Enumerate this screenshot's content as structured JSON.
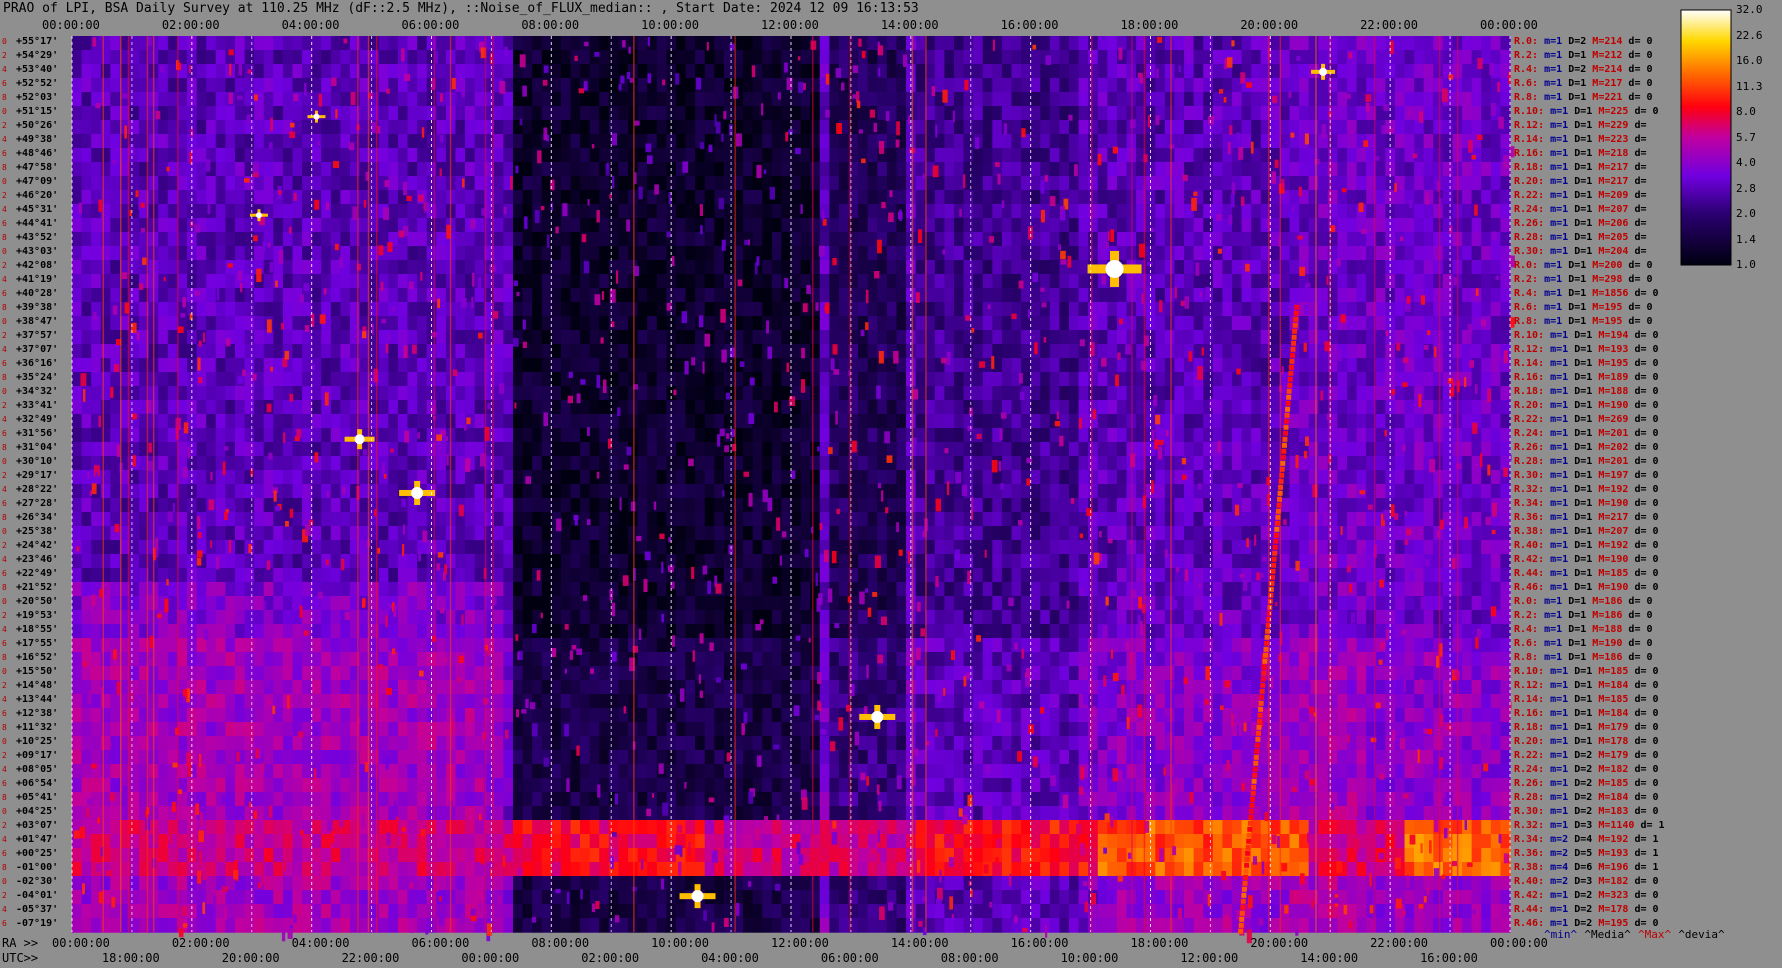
{
  "title": "PRAO of LPI, BSA Daily Survey at 110.25 MHz (dF::2.5 MHz), ::Noise_of_FLUX_median:: , Start Date: 2024 12 09 16:13:53",
  "chart_data": {
    "type": "heatmap",
    "title": "PRAO of LPI, BSA Daily Survey at 110.25 MHz (dF::2.5 MHz), ::Noise_of_FLUX_median:: , Start Date: 2024 12 09 16:13:53",
    "x_top_ticks": [
      "00:00:00",
      "02:00:00",
      "04:00:00",
      "06:00:00",
      "08:00:00",
      "10:00:00",
      "12:00:00",
      "14:00:00",
      "16:00:00",
      "18:00:00",
      "20:00:00",
      "22:00:00",
      "00:00:00"
    ],
    "x_bottom_ra_label": "RA >>",
    "x_bottom_ra_ticks": [
      "00:00:00",
      "02:00:00",
      "04:00:00",
      "06:00:00",
      "08:00:00",
      "10:00:00",
      "12:00:00",
      "14:00:00",
      "16:00:00",
      "18:00:00",
      "20:00:00",
      "22:00:00",
      "00:00:00"
    ],
    "x_bottom_utc_label": "UTC>>",
    "x_bottom_utc_ticks": [
      "18:00:00",
      "20:00:00",
      "22:00:00",
      "00:00:00",
      "02:00:00",
      "04:00:00",
      "06:00:00",
      "08:00:00",
      "10:00:00",
      "12:00:00",
      "14:00:00",
      "16:00:00"
    ],
    "colorbar": {
      "ticks": [
        "32.0",
        "22.6",
        "16.0",
        "11.3",
        "8.0",
        "5.7",
        "4.0",
        "2.8",
        "2.0",
        "1.4",
        "1.0"
      ],
      "scale": "log",
      "range": [
        1.0,
        32.0
      ]
    },
    "y_declinations": [
      "+55°17'",
      "+54°29'",
      "+53°40'",
      "+52°52'",
      "+52°03'",
      "+51°15'",
      "+50°26'",
      "+49°38'",
      "+48°46'",
      "+47°58'",
      "+47°09'",
      "+46°20'",
      "+45°31'",
      "+44°41'",
      "+43°52'",
      "+43°03'",
      "+42°08'",
      "+41°19'",
      "+40°28'",
      "+39°38'",
      "+38°47'",
      "+37°57'",
      "+37°07'",
      "+36°16'",
      "+35°24'",
      "+34°32'",
      "+33°41'",
      "+32°49'",
      "+31°56'",
      "+31°04'",
      "+30°10'",
      "+29°17'",
      "+28°22'",
      "+27°28'",
      "+26°34'",
      "+25°38'",
      "+24°42'",
      "+23°46'",
      "+22°49'",
      "+21°52'",
      "+20°50'",
      "+19°53'",
      "+18°55'",
      "+17°55'",
      "+16°52'",
      "+15°50'",
      "+14°48'",
      "+13°44'",
      "+12°38'",
      "+11°32'",
      "+10°25'",
      "+09°17'",
      "+08°05'",
      "+06°54'",
      "+05°41'",
      "+04°25'",
      "+03°07'",
      "+01°47'",
      "+00°25'",
      "-01°00'",
      "-02°30'",
      "-04°01'",
      "-05°37'",
      "-07°19'"
    ],
    "y_index_labels": [
      "0",
      "2",
      "4",
      "6",
      "8",
      "0",
      "2",
      "4",
      "6",
      "8",
      "0",
      "2",
      "4",
      "6",
      "8",
      "0",
      "2",
      "4",
      "6",
      "8",
      "0",
      "2",
      "4",
      "6",
      "8",
      "0",
      "2",
      "4",
      "6",
      "8",
      "0",
      "2",
      "4",
      "6",
      "8",
      "0",
      "2",
      "4",
      "6",
      "8",
      "0",
      "2",
      "4",
      "6",
      "8",
      "0",
      "2",
      "4",
      "6",
      "8",
      "0",
      "2",
      "4",
      "6",
      "8",
      "0",
      "2",
      "4",
      "6",
      "8",
      "0",
      "2",
      "4",
      "6"
    ],
    "stats_rows": [
      [
        "R.0:",
        "m=1",
        "D=2",
        "M=214",
        "d= 0"
      ],
      [
        "R.2:",
        "m=1",
        "D=1",
        "M=212",
        "d= 0"
      ],
      [
        "R.4:",
        "m=1",
        "D=2",
        "M=214",
        "d= 0"
      ],
      [
        "R.6:",
        "m=1",
        "D=1",
        "M=217",
        "d= 0"
      ],
      [
        "R.8:",
        "m=1",
        "D=1",
        "M=221",
        "d= 0"
      ],
      [
        "R.10:",
        "m=1",
        "D=1",
        "M=225",
        "d= 0"
      ],
      [
        "R.12:",
        "m=1",
        "D=1",
        "M=229",
        "d="
      ],
      [
        "R.14:",
        "m=1",
        "D=1",
        "M=223",
        "d="
      ],
      [
        "R.16:",
        "m=1",
        "D=1",
        "M=218",
        "d="
      ],
      [
        "R.18:",
        "m=1",
        "D=1",
        "M=217",
        "d="
      ],
      [
        "R.20:",
        "m=1",
        "D=1",
        "M=217",
        "d="
      ],
      [
        "R.22:",
        "m=1",
        "D=1",
        "M=209",
        "d="
      ],
      [
        "R.24:",
        "m=1",
        "D=1",
        "M=207",
        "d="
      ],
      [
        "R.26:",
        "m=1",
        "D=1",
        "M=206",
        "d="
      ],
      [
        "R.28:",
        "m=1",
        "D=1",
        "M=205",
        "d="
      ],
      [
        "R.30:",
        "m=1",
        "D=1",
        "M=204",
        "d="
      ],
      [
        "R.0:",
        "m=1",
        "D=1",
        "M=200",
        "d= 0"
      ],
      [
        "R.2:",
        "m=1",
        "D=1",
        "M=298",
        "d= 0"
      ],
      [
        "R.4:",
        "m=1",
        "D=1",
        "M=1856",
        "d= 0"
      ],
      [
        "R.6:",
        "m=1",
        "D=1",
        "M=195",
        "d= 0"
      ],
      [
        "R.8:",
        "m=1",
        "D=1",
        "M=195",
        "d= 0"
      ],
      [
        "R.10:",
        "m=1",
        "D=1",
        "M=194",
        "d= 0"
      ],
      [
        "R.12:",
        "m=1",
        "D=1",
        "M=193",
        "d= 0"
      ],
      [
        "R.14:",
        "m=1",
        "D=1",
        "M=195",
        "d= 0"
      ],
      [
        "R.16:",
        "m=1",
        "D=1",
        "M=189",
        "d= 0"
      ],
      [
        "R.18:",
        "m=1",
        "D=1",
        "M=188",
        "d= 0"
      ],
      [
        "R.20:",
        "m=1",
        "D=1",
        "M=190",
        "d= 0"
      ],
      [
        "R.22:",
        "m=1",
        "D=1",
        "M=269",
        "d= 0"
      ],
      [
        "R.24:",
        "m=1",
        "D=1",
        "M=201",
        "d= 0"
      ],
      [
        "R.26:",
        "m=1",
        "D=1",
        "M=202",
        "d= 0"
      ],
      [
        "R.28:",
        "m=1",
        "D=1",
        "M=201",
        "d= 0"
      ],
      [
        "R.30:",
        "m=1",
        "D=1",
        "M=197",
        "d= 0"
      ],
      [
        "R.32:",
        "m=1",
        "D=1",
        "M=192",
        "d= 0"
      ],
      [
        "R.34:",
        "m=1",
        "D=1",
        "M=190",
        "d= 0"
      ],
      [
        "R.36:",
        "m=1",
        "D=1",
        "M=217",
        "d= 0"
      ],
      [
        "R.38:",
        "m=1",
        "D=1",
        "M=207",
        "d= 0"
      ],
      [
        "R.40:",
        "m=1",
        "D=1",
        "M=192",
        "d= 0"
      ],
      [
        "R.42:",
        "m=1",
        "D=1",
        "M=190",
        "d= 0"
      ],
      [
        "R.44:",
        "m=1",
        "D=1",
        "M=185",
        "d= 0"
      ],
      [
        "R.46:",
        "m=1",
        "D=1",
        "M=190",
        "d= 0"
      ],
      [
        "R.0:",
        "m=1",
        "D=1",
        "M=186",
        "d= 0"
      ],
      [
        "R.2:",
        "m=1",
        "D=1",
        "M=186",
        "d= 0"
      ],
      [
        "R.4:",
        "m=1",
        "D=1",
        "M=188",
        "d= 0"
      ],
      [
        "R.6:",
        "m=1",
        "D=1",
        "M=190",
        "d= 0"
      ],
      [
        "R.8:",
        "m=1",
        "D=1",
        "M=186",
        "d= 0"
      ],
      [
        "R.10:",
        "m=1",
        "D=1",
        "M=185",
        "d= 0"
      ],
      [
        "R.12:",
        "m=1",
        "D=1",
        "M=184",
        "d= 0"
      ],
      [
        "R.14:",
        "m=1",
        "D=1",
        "M=185",
        "d= 0"
      ],
      [
        "R.16:",
        "m=1",
        "D=1",
        "M=184",
        "d= 0"
      ],
      [
        "R.18:",
        "m=1",
        "D=1",
        "M=179",
        "d= 0"
      ],
      [
        "R.20:",
        "m=1",
        "D=1",
        "M=178",
        "d= 0"
      ],
      [
        "R.22:",
        "m=1",
        "D=2",
        "M=179",
        "d= 0"
      ],
      [
        "R.24:",
        "m=1",
        "D=2",
        "M=182",
        "d= 0"
      ],
      [
        "R.26:",
        "m=1",
        "D=2",
        "M=185",
        "d= 0"
      ],
      [
        "R.28:",
        "m=1",
        "D=2",
        "M=184",
        "d= 0"
      ],
      [
        "R.30:",
        "m=1",
        "D=2",
        "M=183",
        "d= 0"
      ],
      [
        "R.32:",
        "m=1",
        "D=3",
        "M=1140",
        "d= 1"
      ],
      [
        "R.34:",
        "m=2",
        "D=4",
        "M=192",
        "d= 1"
      ],
      [
        "R.36:",
        "m=2",
        "D=5",
        "M=193",
        "d= 1"
      ],
      [
        "R.38:",
        "m=4",
        "D=6",
        "M=196",
        "d= 1"
      ],
      [
        "R.40:",
        "m=2",
        "D=3",
        "M=182",
        "d= 0"
      ],
      [
        "R.42:",
        "m=1",
        "D=2",
        "M=323",
        "d= 0"
      ],
      [
        "R.44:",
        "m=1",
        "D=2",
        "M=178",
        "d= 0"
      ],
      [
        "R.46:",
        "m=1",
        "D=2",
        "M=195",
        "d= 0"
      ]
    ],
    "legend": [
      "^min^",
      "^Media^",
      "^Max^",
      "^devia^"
    ]
  },
  "colors": {
    "background": "#8f8f8f",
    "label_red": "#c00000",
    "label_blue": "#000090"
  }
}
